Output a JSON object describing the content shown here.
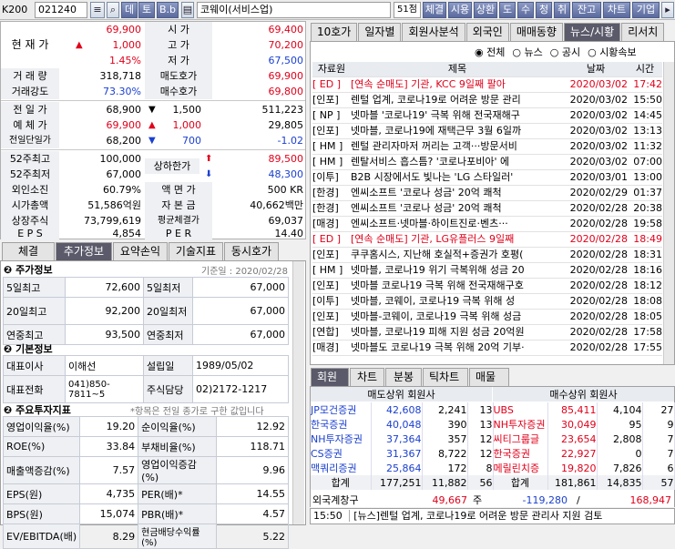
{
  "top": {
    "market": "K200",
    "code": "021240",
    "btns": [
      "데",
      "토",
      "B.b"
    ],
    "name": "코웨이(서비스업)",
    "count": "51점",
    "menu": [
      "체결",
      "시용",
      "상환",
      "도",
      "수",
      "청",
      "취",
      "잔고",
      "차트",
      "기업"
    ]
  },
  "quote": {
    "rows": [
      {
        "l": "현 재 가",
        "v": "69,900",
        "v2": "",
        "l2": "시 가",
        "r": "69,400"
      },
      {
        "l": "",
        "v": "1,000",
        "l2": "고 가",
        "r": "70,200"
      },
      {
        "l": "",
        "v": "1.45%",
        "l2": "저 가",
        "r": "67,500"
      },
      {
        "l": "거 래 량",
        "v": "318,718",
        "l2": "매도호가",
        "r": "69,900"
      },
      {
        "l": "거래강도",
        "v": "73.30%",
        "l2": "매수호가",
        "r": "69,800"
      },
      {
        "l": "전 일 가",
        "v": "68,900",
        "v2": "1,500",
        "r": "511,223"
      },
      {
        "l": "예 체 가",
        "v": "69,900",
        "v2": "1,000",
        "r": "29,805"
      },
      {
        "l": "전일단일가",
        "v": "68,200",
        "v2": "700",
        "r": "-1.02"
      },
      {
        "l": "52주최고",
        "v": "100,000",
        "l2": "상하한가",
        "r": "89,500"
      },
      {
        "l": "52주최저",
        "v": "67,000",
        "r": "48,300"
      },
      {
        "l": "외인소진",
        "v": "60.79%",
        "l2": "액 면 가",
        "r": "500 KR"
      },
      {
        "l": "시가총액",
        "v": "51,586억원",
        "l2": "자 본 금",
        "r": "40,662백만"
      },
      {
        "l": "상장주식",
        "v": "73,799,619",
        "l2": "평균체결가",
        "r": "69,037"
      },
      {
        "l": "E P S",
        "v": "4,854",
        "l2": "P E R",
        "r": "14.40"
      }
    ],
    "topnum": "69,900"
  },
  "ltabs": [
    "체결",
    "추가정보",
    "요약손익",
    "기술지표",
    "동시호가"
  ],
  "info": {
    "sec1": "주가정보",
    "date": "기준일 : 2020/02/28",
    "prices": [
      [
        "5일최고",
        "72,600",
        "5일최저",
        "67,000"
      ],
      [
        "20일최고",
        "92,200",
        "20일최저",
        "67,000"
      ],
      [
        "연중최고",
        "93,500",
        "연중최저",
        "67,000"
      ]
    ],
    "sec2": "기본정보",
    "basic": [
      [
        "대표이사",
        "이해선",
        "설립일",
        "1989/05/02"
      ],
      [
        "대표전화",
        "041)850-7811~5",
        "주식담당",
        "02)2172-1217"
      ]
    ],
    "sec3": "주요투자지표",
    "note": "*항목은 전일 종가로 구한 값입니다",
    "ind": [
      [
        "영업이익율(%)",
        "19.20",
        "순이익율(%)",
        "12.92"
      ],
      [
        "ROE(%)",
        "33.84",
        "부채비율(%)",
        "118.71"
      ],
      [
        "매출액증감(%)",
        "7.57",
        "영업이익증감(%)",
        "9.96"
      ],
      [
        "EPS(원)",
        "4,735",
        "PER(배)*",
        "14.55"
      ],
      [
        "BPS(원)",
        "15,074",
        "PBR(배)*",
        "4.57"
      ],
      [
        "EV/EBITDA(배)",
        "8.29",
        "현금배당수익률(%)",
        "5.22"
      ]
    ]
  },
  "rtabs": [
    "10호가",
    "일자별",
    "회원사분석",
    "외국인",
    "매매동향",
    "뉴스/시황",
    "리서치"
  ],
  "filter": [
    "전체",
    "뉴스",
    "공시",
    "시황속보"
  ],
  "newshead": [
    "자료원",
    "제목",
    "날짜",
    "시간"
  ],
  "news": [
    {
      "s": "[ ED ]",
      "t": "[연속 순매도] 기관, KCC 9일째 팔아",
      "d": "2020/03/02",
      "tm": "17:42",
      "hl": true
    },
    {
      "s": "[인포]",
      "t": "렌털 업계, 코로나19로 어려운 방문 관리",
      "d": "2020/03/02",
      "tm": "15:50"
    },
    {
      "s": "[ NP ]",
      "t": "넷마블 '코로나19' 극복 위해 전국재해구",
      "d": "2020/03/02",
      "tm": "14:45"
    },
    {
      "s": "[인포]",
      "t": "넷마블, 코로나19에 재택근무 3월 6일까",
      "d": "2020/03/02",
      "tm": "13:13"
    },
    {
      "s": "[ HM ]",
      "t": "렌털 관리자마저 꺼리는 고객···방문서비",
      "d": "2020/03/02",
      "tm": "11:32"
    },
    {
      "s": "[ HM ]",
      "t": "렌탈서비스 흡스틈? '코로나포비아' 에",
      "d": "2020/03/02",
      "tm": "07:00"
    },
    {
      "s": "[이투]",
      "t": "B2B 시장에서도 빛나는 'LG 스타일러'",
      "d": "2020/03/01",
      "tm": "13:00"
    },
    {
      "s": "[한경]",
      "t": "엔씨소프트 '코로나 성금' 20억 쾌척",
      "d": "2020/02/29",
      "tm": "01:37"
    },
    {
      "s": "[한경]",
      "t": "엔씨소프트 '코로나 성금' 20억 쾌척",
      "d": "2020/02/28",
      "tm": "20:38"
    },
    {
      "s": "[매경]",
      "t": "엔씨소프트·넷마블·하이트진로·벤츠···",
      "d": "2020/02/28",
      "tm": "19:58"
    },
    {
      "s": "[ ED ]",
      "t": "[연속 순매도] 기관, LG유플러스 9일째",
      "d": "2020/02/28",
      "tm": "18:49",
      "hl": true
    },
    {
      "s": "[인포]",
      "t": "쿠쿠홈시스, 지난해 호실적+증권가 호평(",
      "d": "2020/02/28",
      "tm": "18:31"
    },
    {
      "s": "[ HM ]",
      "t": "넷마블, 코로나19 위기 극복위해 성금 20",
      "d": "2020/02/28",
      "tm": "18:16"
    },
    {
      "s": "[인포]",
      "t": "넷마블 코로나19 극복 위해 전국재해구호",
      "d": "2020/02/28",
      "tm": "18:12"
    },
    {
      "s": "[이투]",
      "t": "넷마블, 코웨이, 코로나19 극복 위해 성",
      "d": "2020/02/28",
      "tm": "18:08"
    },
    {
      "s": "[인포]",
      "t": "넷마블-코웨이, 코로나19 극복 위해 성금",
      "d": "2020/02/28",
      "tm": "18:05"
    },
    {
      "s": "[연합]",
      "t": "넷마블, 코로나19 피해 지원 성금 20억원",
      "d": "2020/02/28",
      "tm": "17:58"
    },
    {
      "s": "[매경]",
      "t": "넷마블도 코로나19 극복 위해 20억 기부·",
      "d": "2020/02/28",
      "tm": "17:55"
    }
  ],
  "btabs": [
    "회원사",
    "차트",
    "분봉",
    "틱차트",
    "매물대"
  ],
  "broker": {
    "hsell": "매도상위 회원사",
    "hbuy": "매수상위 회원사",
    "rows": [
      [
        "JP모건증권",
        "42,608",
        "2,241",
        "13",
        "UBS",
        "85,411",
        "4,104",
        "27"
      ],
      [
        "한국증권",
        "40,048",
        "390",
        "13",
        "NH투자증권",
        "30,049",
        "95",
        "9"
      ],
      [
        "NH투자증권",
        "37,364",
        "357",
        "12",
        "씨티그룹글",
        "23,654",
        "2,808",
        "7"
      ],
      [
        "CS증권",
        "31,367",
        "8,722",
        "12",
        "한국증권",
        "22,927",
        "0",
        "7"
      ],
      [
        "맥쿼리증권",
        "25,864",
        "172",
        "8",
        "메릴린치증",
        "19,820",
        "7,826",
        "6"
      ]
    ],
    "total": [
      "합계",
      "177,251",
      "11,882",
      "56",
      "합계",
      "181,861",
      "14,835",
      "57"
    ],
    "foreign": [
      "외국계창구",
      "49,667",
      "주",
      "-119,280",
      "/",
      "168,947"
    ]
  },
  "ticker": {
    "time": "15:50",
    "text": "[뉴스]렌털 업계, 코로나19로 어려운 방문 관리사 지원 검토"
  }
}
